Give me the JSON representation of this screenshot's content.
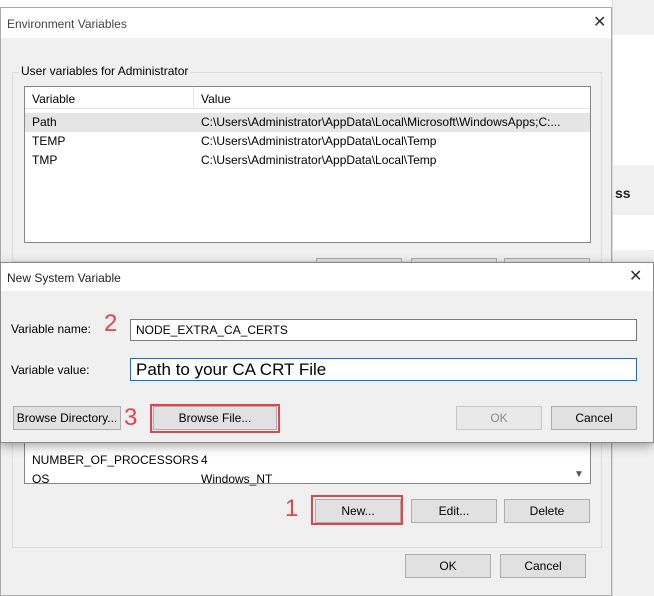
{
  "env_dialog": {
    "title": "Environment Variables",
    "user_group_label": "User variables for Administrator",
    "columns": [
      "Variable",
      "Value"
    ],
    "user_vars": [
      {
        "name": "Path",
        "value": "C:\\Users\\Administrator\\AppData\\Local\\Microsoft\\WindowsApps;C:..."
      },
      {
        "name": "TEMP",
        "value": "C:\\Users\\Administrator\\AppData\\Local\\Temp"
      },
      {
        "name": "TMP",
        "value": "C:\\Users\\Administrator\\AppData\\Local\\Temp"
      }
    ],
    "system_vars_visible": [
      {
        "name": "NUMBER_OF_PROCESSORS",
        "value": "4"
      },
      {
        "name": "OS",
        "value": "Windows_NT"
      }
    ],
    "system_buttons": {
      "new": "New...",
      "edit": "Edit...",
      "delete": "Delete"
    },
    "ok": "OK",
    "cancel": "Cancel"
  },
  "new_var_dialog": {
    "title": "New System Variable",
    "name_label": "Variable name:",
    "name_value": "NODE_EXTRA_CA_CERTS",
    "value_label": "Variable value:",
    "value_value": "Path to your CA CRT File",
    "browse_directory": "Browse Directory...",
    "browse_file": "Browse File...",
    "ok": "OK",
    "cancel": "Cancel"
  },
  "background_window": {
    "partial_text": "ss"
  },
  "annotations": {
    "step1": "1",
    "step2": "2",
    "step3": "3",
    "color": "#e0454b"
  },
  "icons": {
    "close": "close-icon",
    "scroll_down": "chevron-down-icon"
  }
}
